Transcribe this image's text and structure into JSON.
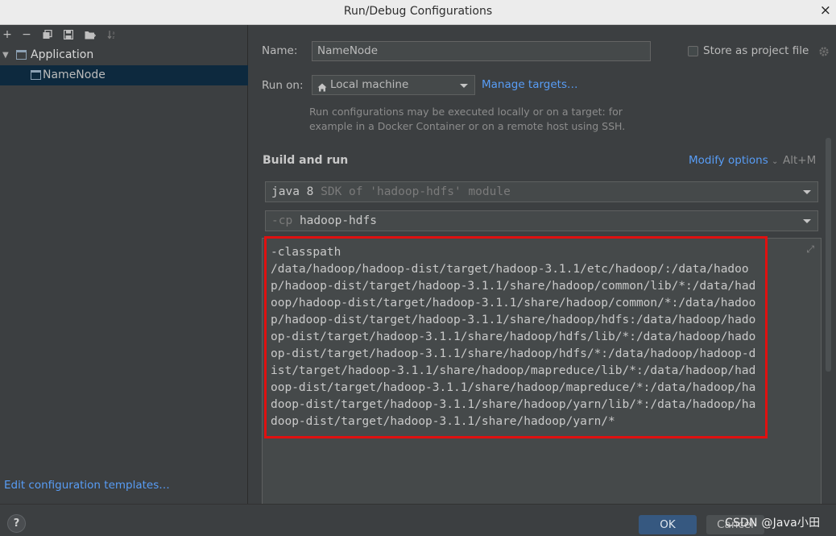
{
  "window": {
    "title": "Run/Debug Configurations",
    "close_icon": "×"
  },
  "toolbar": {
    "add": "+",
    "remove": "−"
  },
  "tree": {
    "group": "Application",
    "item": "NameNode"
  },
  "left_footer": {
    "edit_templates": "Edit configuration templates…"
  },
  "form": {
    "name_label": "Name:",
    "name_value": "NameNode",
    "store_label": "Store as project file",
    "run_on_label": "Run on:",
    "run_on_value": "Local machine",
    "manage_targets": "Manage targets…",
    "run_hint": "Run configurations may be executed locally or on a target: for example in a Docker Container or on a remote host using SSH.",
    "build_heading": "Build and run",
    "modify_options": "Modify options",
    "modify_shortcut": "Alt+M",
    "jdk_main": "java 8",
    "jdk_hint": "SDK of 'hadoop-hdfs' module",
    "cp_flag": "-cp",
    "cp_value": "hadoop-hdfs",
    "vm_options": "-classpath\n/data/hadoop/hadoop-dist/target/hadoop-3.1.1/etc/hadoop/:/data/hadoop/hadoop-dist/target/hadoop-3.1.1/share/hadoop/common/lib/*:/data/hadoop/hadoop-dist/target/hadoop-3.1.1/share/hadoop/common/*:/data/hadoop/hadoop-dist/target/hadoop-3.1.1/share/hadoop/hdfs:/data/hadoop/hadoop-dist/target/hadoop-3.1.1/share/hadoop/hdfs/lib/*:/data/hadoop/hadoop-dist/target/hadoop-3.1.1/share/hadoop/hdfs/*:/data/hadoop/hadoop-dist/target/hadoop-3.1.1/share/hadoop/mapreduce/lib/*:/data/hadoop/hadoop-dist/target/hadoop-3.1.1/share/hadoop/mapreduce/*:/data/hadoop/hadoop-dist/target/hadoop-3.1.1/share/hadoop/yarn/lib/*:/data/hadoop/hadoop-dist/target/hadoop-3.1.1/share/hadoop/yarn/*"
  },
  "buttons": {
    "ok": "OK",
    "cancel": "Cancel",
    "help": "?"
  },
  "watermark": "CSDN @Java小田",
  "colors": {
    "accent_link": "#589df6",
    "selection": "#0d293e",
    "highlight_border": "#e01010",
    "ok_button": "#365880"
  }
}
